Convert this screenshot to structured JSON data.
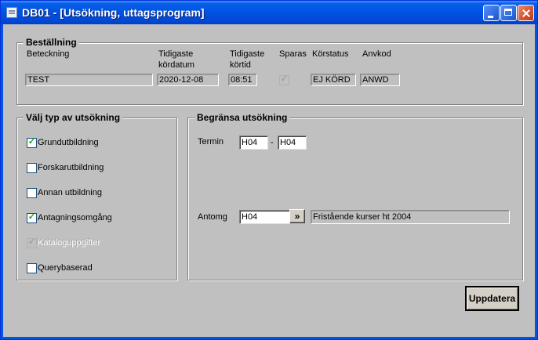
{
  "window": {
    "title": "DB01 - [Utsökning, uttagsprogram]"
  },
  "order_group": {
    "title": "Beställning",
    "designation_label": "Beteckning",
    "designation_value": "TEST",
    "date_label_line1": "Tidigaste",
    "date_label_line2": "kördatum",
    "date_value": "2020-12-08",
    "time_label_line1": "Tidigaste",
    "time_label_line2": "körtid",
    "time_value": "08:51",
    "save_label": "Sparas",
    "save_checked": true,
    "runstatus_label": "Körstatus",
    "runstatus_value": "EJ KÖRD",
    "usercode_label": "Anvkod",
    "usercode_value": "ANWD"
  },
  "type_group": {
    "title": "Välj typ av utsökning",
    "options": [
      {
        "label": "Grundutbildning",
        "checked": true,
        "disabled": false
      },
      {
        "label": "Forskarutbildning",
        "checked": false,
        "disabled": false
      },
      {
        "label": "Annan utbildning",
        "checked": false,
        "disabled": false
      },
      {
        "label": "Antagningsomgång",
        "checked": true,
        "disabled": false
      },
      {
        "label": "Kataloguppgifter",
        "checked": true,
        "disabled": true
      },
      {
        "label": "Querybaserad",
        "checked": false,
        "disabled": false
      }
    ]
  },
  "limit_group": {
    "title": "Begränsa utsökning",
    "term_label": "Termin",
    "term_from": "H04",
    "term_separator": "-",
    "term_to": "H04",
    "admission_label": "Antomg",
    "admission_value": "H04",
    "admission_button": "»",
    "admission_description": "Fristående kurser ht 2004"
  },
  "actions": {
    "update_label": "Uppdatera"
  }
}
